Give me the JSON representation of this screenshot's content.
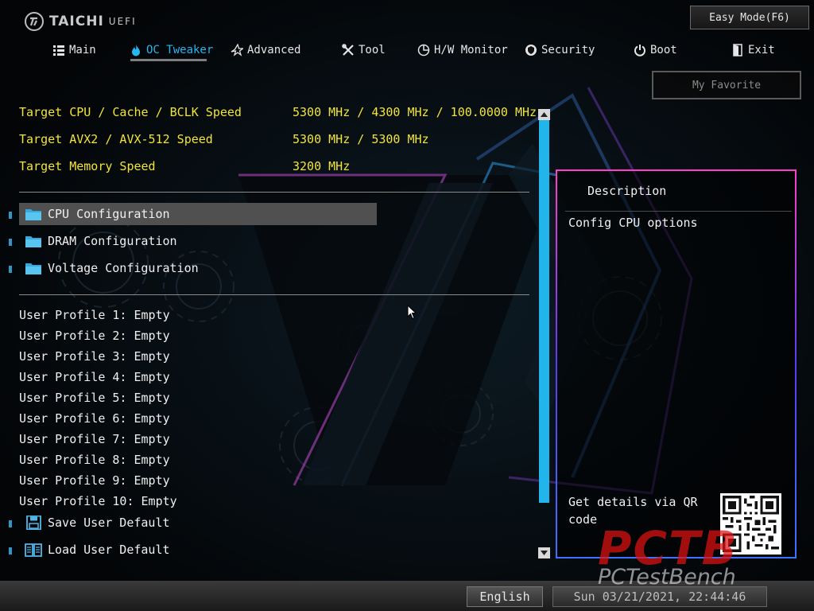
{
  "brand": {
    "logo_text": "TAICHI",
    "logo_sub": "UEFI"
  },
  "header": {
    "easy_mode_label": "Easy Mode(F6)",
    "my_favorite_label": "My Favorite"
  },
  "tabs": [
    {
      "label": "Main",
      "icon": "list-icon",
      "active": false
    },
    {
      "label": "OC Tweaker",
      "icon": "flame-icon",
      "active": true
    },
    {
      "label": "Advanced",
      "icon": "star-icon",
      "active": false
    },
    {
      "label": "Tool",
      "icon": "tools-icon",
      "active": false
    },
    {
      "label": "H/W Monitor",
      "icon": "monitor-icon",
      "active": false
    },
    {
      "label": "Security",
      "icon": "shield-icon",
      "active": false
    },
    {
      "label": "Boot",
      "icon": "power-icon",
      "active": false
    },
    {
      "label": "Exit",
      "icon": "exit-icon",
      "active": false
    }
  ],
  "info": [
    {
      "label": "Target CPU / Cache / BCLK Speed",
      "value": "5300 MHz / 4300 MHz / 100.0000 MHz"
    },
    {
      "label": "Target AVX2 / AVX-512 Speed",
      "value": "5300 MHz / 5300 MHz"
    },
    {
      "label": "Target Memory Speed",
      "value": "3200 MHz"
    }
  ],
  "configs": [
    {
      "label": "CPU Configuration",
      "selected": true
    },
    {
      "label": "DRAM Configuration",
      "selected": false
    },
    {
      "label": "Voltage Configuration",
      "selected": false
    }
  ],
  "profiles": [
    "User Profile 1: Empty",
    "User Profile 2: Empty",
    "User Profile 3: Empty",
    "User Profile 4: Empty",
    "User Profile 5: Empty",
    "User Profile 6: Empty",
    "User Profile 7: Empty",
    "User Profile 8: Empty",
    "User Profile 9: Empty",
    "User Profile 10: Empty"
  ],
  "actions": [
    {
      "label": "Save User Default",
      "icon": "save-icon"
    },
    {
      "label": "Load User Default",
      "icon": "book-icon"
    }
  ],
  "description": {
    "title": "Description",
    "text": "Config CPU options",
    "qr_text": "Get details via QR code"
  },
  "footer": {
    "language": "English",
    "datetime": "Sun 03/21/2021, 22:44:46"
  },
  "watermark": {
    "big": "PCTB",
    "small": "PCTestBench"
  },
  "colors": {
    "accent": "#22b5ec",
    "highlight_text": "#f1e43a",
    "selected_row": "#505050",
    "watermark_red": "#e01010"
  }
}
